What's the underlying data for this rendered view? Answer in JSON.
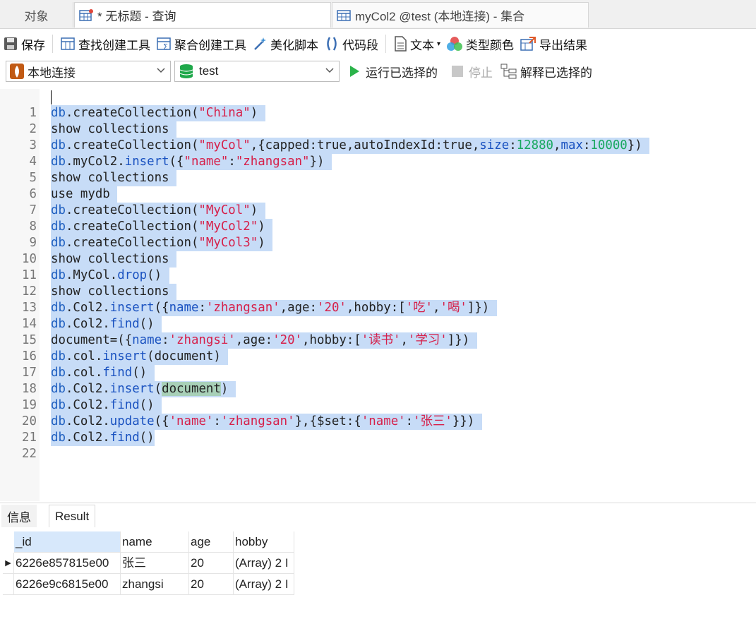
{
  "tabs": {
    "objects": "对象",
    "query": "* 无标题 - 查询",
    "collection": "myCol2 @test (本地连接) - 集合"
  },
  "toolbar": {
    "save": "保存",
    "find_builder": "查找创建工具",
    "aggregate_builder": "聚合创建工具",
    "beautify": "美化脚本",
    "snippet": "代码段",
    "text": "文本",
    "type_color": "类型颜色",
    "export": "导出结果"
  },
  "connection": {
    "connection_value": "本地连接",
    "database_value": "test",
    "run_selected": "运行已选择的",
    "stop": "停止",
    "explain_selected": "解释已选择的"
  },
  "editor": {
    "line_numbers": [
      "1",
      "2",
      "3",
      "4",
      "5",
      "6",
      "7",
      "8",
      "9",
      "10",
      "11",
      "12",
      "13",
      "14",
      "15",
      "16",
      "17",
      "18",
      "19",
      "20",
      "21",
      "22"
    ]
  },
  "results": {
    "tab_info": "信息",
    "tab_result": "Result",
    "columns": [
      "_id",
      "name",
      "age",
      "hobby"
    ],
    "rows": [
      [
        "6226e857815e00",
        "张三",
        "20",
        "(Array) 2 I"
      ],
      [
        "6226e9c6815e00",
        "zhangsi",
        "20",
        "(Array) 2 I"
      ]
    ]
  },
  "colors": {
    "selection": "#c7dcf7",
    "string": "#d6204a",
    "number": "#19a860",
    "keyword": "#1a52c0",
    "run_green": "#2bb34a"
  }
}
